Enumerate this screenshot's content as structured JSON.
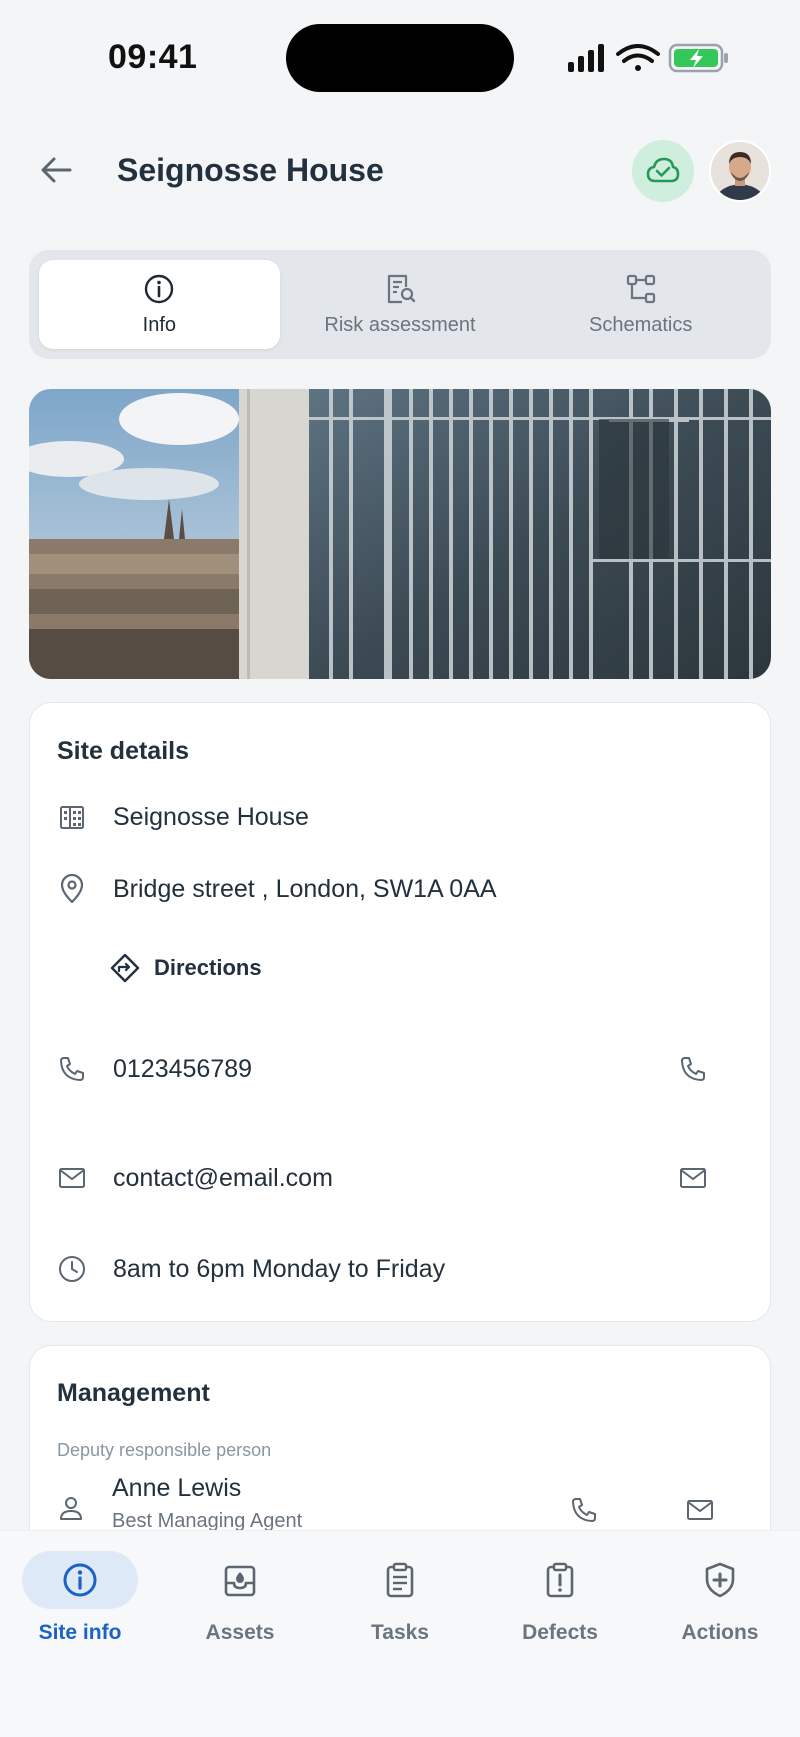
{
  "status_bar": {
    "time": "09:41"
  },
  "header": {
    "title": "Seignosse House",
    "back_icon": "arrow-left-icon",
    "sync_icon": "cloud-check-icon"
  },
  "tabs": [
    {
      "label": "Info",
      "icon": "info-icon",
      "active": true
    },
    {
      "label": "Risk assessment",
      "icon": "document-search-icon",
      "active": false
    },
    {
      "label": "Schematics",
      "icon": "schematic-icon",
      "active": false
    }
  ],
  "site_details": {
    "title": "Site details",
    "name": "Seignosse House",
    "address": "Bridge street , London, SW1A 0AA",
    "directions_label": "Directions",
    "phone": "0123456789",
    "email": "contact@email.com",
    "hours": "8am to 6pm Monday to Friday"
  },
  "management": {
    "title": "Management",
    "subtitle": "Deputy responsible person",
    "person_name": "Anne Lewis",
    "person_role": "Best Managing Agent"
  },
  "bottom_nav": [
    {
      "label": "Site info",
      "icon": "info-icon",
      "active": true
    },
    {
      "label": "Assets",
      "icon": "assets-icon",
      "active": false
    },
    {
      "label": "Tasks",
      "icon": "clipboard-icon",
      "active": false
    },
    {
      "label": "Defects",
      "icon": "defect-icon",
      "active": false
    },
    {
      "label": "Actions",
      "icon": "shield-plus-icon",
      "active": false
    }
  ],
  "colors": {
    "accent": "#1c62c6",
    "sync_bg": "#cfeedd",
    "battery_green": "#35c759"
  }
}
